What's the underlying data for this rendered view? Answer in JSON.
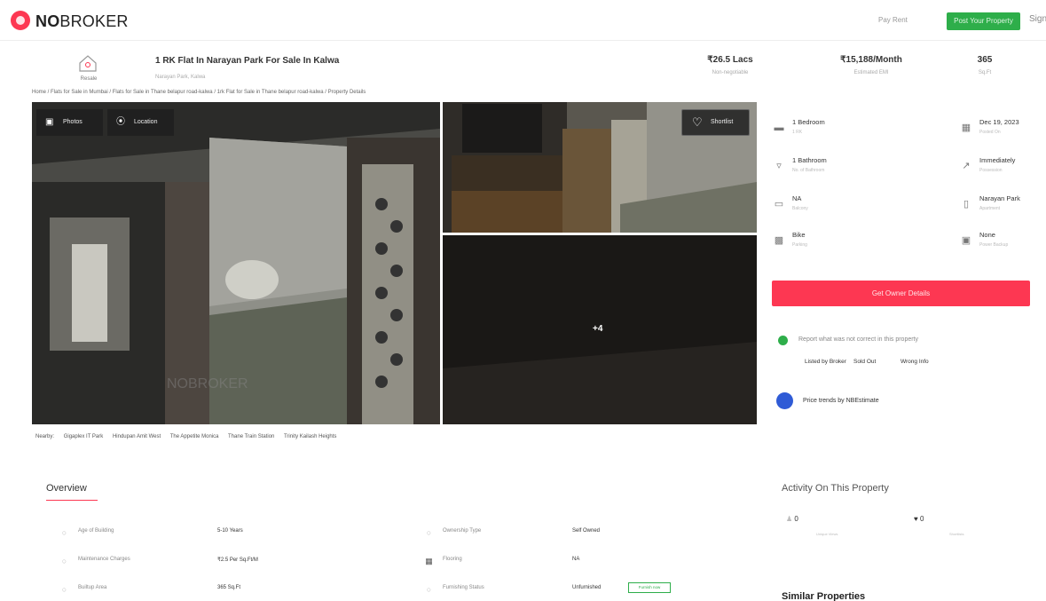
{
  "header": {
    "logo": "NOBROKER",
    "logo_bold": "NO",
    "logo_rest": "BROKER",
    "pay_rent": "Pay Rent",
    "post_property": "Post Your Property",
    "user_menu": "Sign"
  },
  "property": {
    "icon_label": "Resale",
    "title": "1 RK Flat In Narayan Park For Sale In Kalwa",
    "subtitle": "Narayan Park, Kalwa",
    "price": "₹26.5 Lacs",
    "price_sub": "Non-negotiable",
    "emi": "₹15,188/Month",
    "emi_sub": "Estimated EMI",
    "area": "365",
    "area_sub": "Sq.Ft"
  },
  "breadcrumb": "Home / Flats for Sale in Mumbai / Flats for Sale in Thane belapur road-kalwa / 1rk Flat for Sale in Thane belapur road-kalwa / Property Details",
  "gallery": {
    "photos_btn": "Photos",
    "location_btn": "Location",
    "shortlist_btn": "Shortlist",
    "more_photos": "+4",
    "watermark": "NOBROKER"
  },
  "nearby": {
    "label": "Nearby:",
    "places": [
      "Gigaplex IT Park",
      "Hindupan Amit West",
      "The Appetite Monica",
      "Thane Train Station",
      "Trinity Kailash Heights"
    ]
  },
  "details": [
    {
      "title": "1 Bedroom",
      "sub": "1 RK",
      "icon": "bed-icon"
    },
    {
      "title": "Dec 19, 2023",
      "sub": "Posted On",
      "icon": "calendar-icon"
    },
    {
      "title": "1 Bathroom",
      "sub": "No. of Bathroom",
      "icon": "bath-icon"
    },
    {
      "title": "Immediately",
      "sub": "Possession",
      "icon": "key-icon"
    },
    {
      "title": "NA",
      "sub": "Balcony",
      "icon": "sofa-icon"
    },
    {
      "title": "Narayan Park",
      "sub": "Apartment",
      "icon": "building-icon"
    },
    {
      "title": "Bike",
      "sub": "Parking",
      "icon": "parking-icon"
    },
    {
      "title": "None",
      "sub": "Power Backup",
      "icon": "power-icon"
    }
  ],
  "owner_btn": "Get Owner Details",
  "report": {
    "text": "Report what was not correct in this property",
    "options": [
      "Listed by Broker",
      "Sold Out",
      "Wrong Info"
    ]
  },
  "price_trends": "Price trends by NBEstimate",
  "overview": {
    "title": "Overview",
    "rows": [
      {
        "label": "Age of Building",
        "value": "5-10 Years",
        "label2": "Ownership Type",
        "value2": "Self Owned"
      },
      {
        "label": "Maintenance Charges",
        "value": "₹2.5 Per Sq.Ft/M",
        "label2": "Flooring",
        "value2": "NA"
      },
      {
        "label": "Builtup Area",
        "value": "365 Sq.Ft",
        "label2": "Furnishing Status",
        "value2": "Unfurnished"
      }
    ],
    "furnish_tag": "Furnish now"
  },
  "activity": {
    "title": "Activity On This Property",
    "views": "0",
    "views_label": "Unique Views",
    "shortlists": "0",
    "shortlists_label": "Shortlists"
  },
  "similar_title": "Similar Properties",
  "colors": {
    "brand": "#fd3752",
    "green": "#2eae4a",
    "blue": "#2f5bd6"
  }
}
